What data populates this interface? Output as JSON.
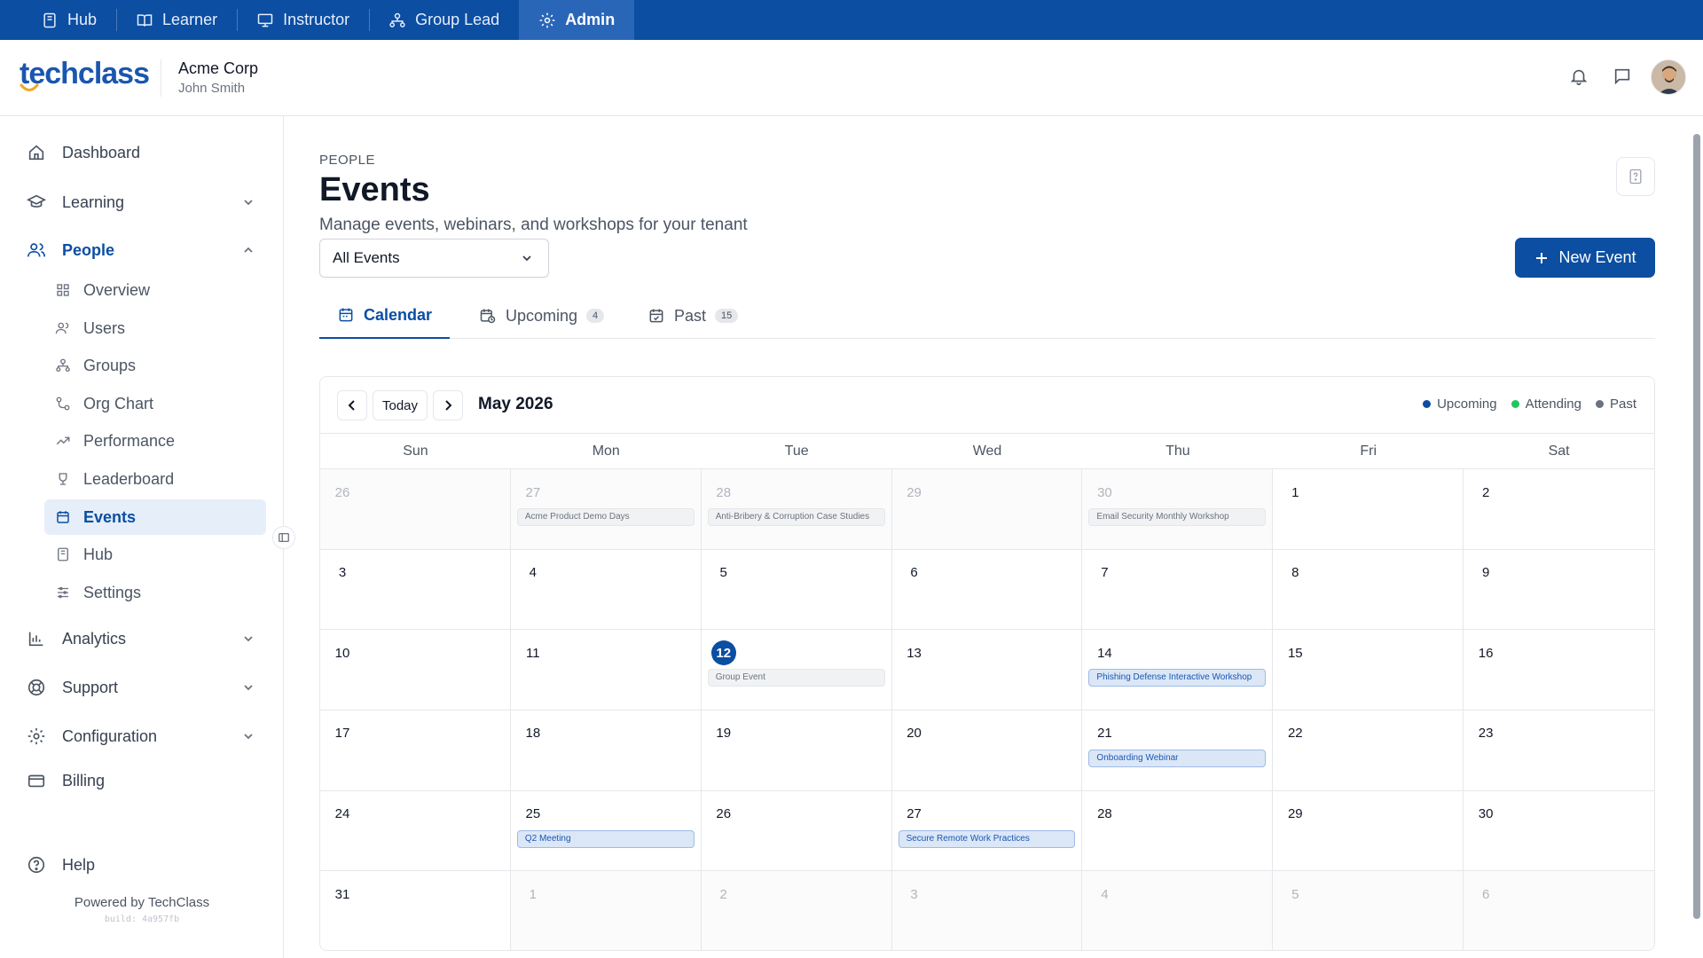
{
  "roles": [
    {
      "label": "Hub",
      "icon": "book-icon",
      "active": false
    },
    {
      "label": "Learner",
      "icon": "open-book-icon",
      "active": false
    },
    {
      "label": "Instructor",
      "icon": "presentation-icon",
      "active": false
    },
    {
      "label": "Group Lead",
      "icon": "org-icon",
      "active": false
    },
    {
      "label": "Admin",
      "icon": "gear-icon",
      "active": true
    }
  ],
  "header": {
    "logo_text": "techclass",
    "tenant_name": "Acme Corp",
    "user_name": "John Smith"
  },
  "sidebar": {
    "items": [
      {
        "label": "Dashboard",
        "icon": "home-icon"
      },
      {
        "label": "Learning",
        "icon": "graduation-cap-icon"
      },
      {
        "label": "People",
        "icon": "users-icon"
      },
      {
        "label": "Analytics",
        "icon": "bar-chart-icon"
      },
      {
        "label": "Support",
        "icon": "lifebuoy-icon"
      },
      {
        "label": "Configuration",
        "icon": "gear-icon"
      },
      {
        "label": "Billing",
        "icon": "credit-card-icon"
      },
      {
        "label": "Help",
        "icon": "help-circle-icon"
      }
    ],
    "people_sub": [
      {
        "label": "Overview",
        "icon": "grid-icon"
      },
      {
        "label": "Users",
        "icon": "users-icon"
      },
      {
        "label": "Groups",
        "icon": "org-icon"
      },
      {
        "label": "Org Chart",
        "icon": "org-chart-icon"
      },
      {
        "label": "Performance",
        "icon": "trend-icon"
      },
      {
        "label": "Leaderboard",
        "icon": "trophy-icon"
      },
      {
        "label": "Events",
        "icon": "calendar-icon"
      },
      {
        "label": "Hub",
        "icon": "book-icon"
      },
      {
        "label": "Settings",
        "icon": "sliders-icon"
      }
    ],
    "powered_by": "Powered by TechClass",
    "build": "build: 4a957fb"
  },
  "page": {
    "eyebrow": "PEOPLE",
    "title": "Events",
    "subtitle": "Manage events, webinars, and workshops for your tenant",
    "filter_value": "All Events",
    "new_button": "New Event"
  },
  "tabs": [
    {
      "label": "Calendar",
      "count": ""
    },
    {
      "label": "Upcoming",
      "count": "4"
    },
    {
      "label": "Past",
      "count": "15"
    }
  ],
  "calendar": {
    "today_label": "Today",
    "month_title": "May 2026",
    "legend": [
      {
        "label": "Upcoming",
        "color": "#0b4ea2"
      },
      {
        "label": "Attending",
        "color": "#22c55e"
      },
      {
        "label": "Past",
        "color": "#6b7280"
      }
    ],
    "weekdays": [
      "Sun",
      "Mon",
      "Tue",
      "Wed",
      "Thu",
      "Fri",
      "Sat"
    ],
    "days": [
      {
        "d": "26",
        "other": true
      },
      {
        "d": "27",
        "other": true,
        "event": "Acme Product Demo Days",
        "kind": "past"
      },
      {
        "d": "28",
        "other": true,
        "event": "Anti-Bribery & Corruption Case Studies",
        "kind": "past"
      },
      {
        "d": "29",
        "other": true
      },
      {
        "d": "30",
        "other": true,
        "event": "Email Security Monthly Workshop",
        "kind": "past"
      },
      {
        "d": "1"
      },
      {
        "d": "2"
      },
      {
        "d": "3"
      },
      {
        "d": "4"
      },
      {
        "d": "5"
      },
      {
        "d": "6"
      },
      {
        "d": "7"
      },
      {
        "d": "8"
      },
      {
        "d": "9"
      },
      {
        "d": "10"
      },
      {
        "d": "11"
      },
      {
        "d": "12",
        "today": true,
        "event": "Group Event",
        "kind": "past"
      },
      {
        "d": "13"
      },
      {
        "d": "14",
        "event": "Phishing Defense Interactive Workshop",
        "kind": "upcoming"
      },
      {
        "d": "15"
      },
      {
        "d": "16"
      },
      {
        "d": "17"
      },
      {
        "d": "18"
      },
      {
        "d": "19"
      },
      {
        "d": "20"
      },
      {
        "d": "21",
        "event": "Onboarding Webinar",
        "kind": "upcoming"
      },
      {
        "d": "22"
      },
      {
        "d": "23"
      },
      {
        "d": "24"
      },
      {
        "d": "25",
        "event": "Q2 Meeting",
        "kind": "upcoming"
      },
      {
        "d": "26"
      },
      {
        "d": "27",
        "event": "Secure Remote Work Practices",
        "kind": "upcoming"
      },
      {
        "d": "28"
      },
      {
        "d": "29"
      },
      {
        "d": "30"
      },
      {
        "d": "31"
      },
      {
        "d": "1",
        "other": true
      },
      {
        "d": "2",
        "other": true
      },
      {
        "d": "3",
        "other": true
      },
      {
        "d": "4",
        "other": true
      },
      {
        "d": "5",
        "other": true
      },
      {
        "d": "6",
        "other": true
      }
    ]
  }
}
